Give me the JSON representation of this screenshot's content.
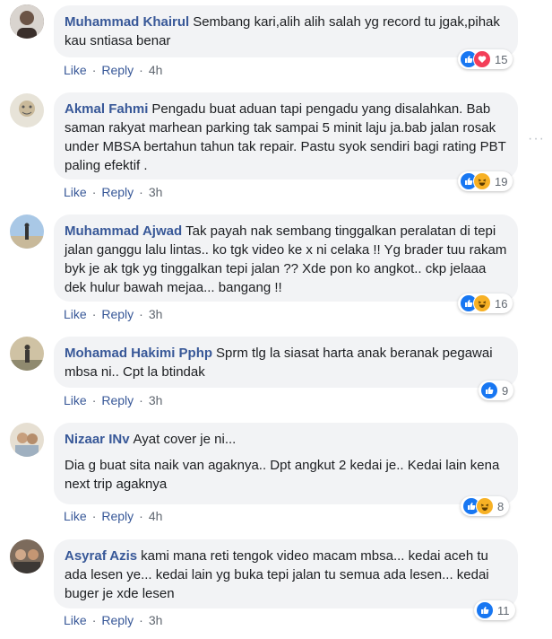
{
  "comments": [
    {
      "author": "Muhammad Khairul",
      "text": "Sembang kari,alih alih salah yg record tu jgak,pihak kau sntiasa benar",
      "extra": "",
      "like_label": "Like",
      "reply_label": "Reply",
      "time": "4h",
      "reactions": [
        "like",
        "love"
      ],
      "count": "15",
      "avatar_color": "#5a4a42"
    },
    {
      "author": "Akmal Fahmi",
      "text": "Pengadu buat aduan tapi pengadu yang disalahkan. Bab saman rakyat marhean parking tak sampai 5 minit laju ja.bab jalan rosak under MBSA bertahun tahun tak repair. Pastu syok sendiri bagi rating PBT paling efektif .",
      "extra": "",
      "like_label": "Like",
      "reply_label": "Reply",
      "time": "3h",
      "reactions": [
        "like",
        "haha"
      ],
      "count": "19",
      "avatar_color": "#c9c2b0"
    },
    {
      "author": "Muhammad Ajwad",
      "text": "Tak payah nak sembang tinggalkan peralatan di tepi jalan ganggu lalu lintas.. ko tgk video ke x ni celaka !! Yg brader tuu rakam byk je ak tgk yg tinggalkan tepi jalan ?? Xde pon ko angkot.. ckp jelaaa dek hulur bawah mejaa... bangang !!",
      "extra": "",
      "like_label": "Like",
      "reply_label": "Reply",
      "time": "3h",
      "reactions": [
        "like",
        "haha"
      ],
      "count": "16",
      "avatar_color": "#8fb4d6"
    },
    {
      "author": "Mohamad Hakimi Pphp",
      "text": "Sprm tlg la siasat harta anak beranak pegawai mbsa ni.. Cpt la btindak",
      "extra": "",
      "like_label": "Like",
      "reply_label": "Reply",
      "time": "3h",
      "reactions": [
        "like"
      ],
      "count": "9",
      "avatar_color": "#b9a98a"
    },
    {
      "author": "Nizaar INv",
      "text": "Ayat cover je ni...",
      "extra": "Dia g buat sita naik van agaknya.. Dpt angkut 2 kedai je.. Kedai lain kena next trip agaknya",
      "like_label": "Like",
      "reply_label": "Reply",
      "time": "4h",
      "reactions": [
        "like",
        "haha"
      ],
      "count": "8",
      "avatar_color": "#d8cfc0"
    },
    {
      "author": "Asyraf Azis",
      "text": "kami mana reti tengok video macam mbsa... kedai aceh tu ada lesen ye... kedai lain yg buka tepi jalan tu semua ada lesen... kedai buger je xde lesen",
      "extra": "",
      "like_label": "Like",
      "reply_label": "Reply",
      "time": "3h",
      "reactions": [
        "like"
      ],
      "count": "11",
      "avatar_color": "#7a5a48"
    }
  ],
  "more_options": "···"
}
